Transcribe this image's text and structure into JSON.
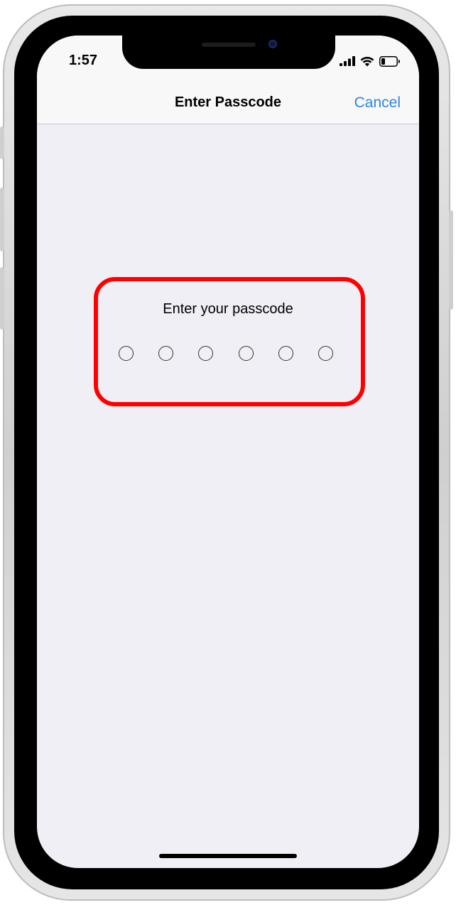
{
  "status_bar": {
    "time": "1:57",
    "icons": [
      "cellular-signal-icon",
      "wifi-icon",
      "battery-icon"
    ],
    "battery_level": 0.25
  },
  "nav_bar": {
    "title": "Enter Passcode",
    "cancel_label": "Cancel"
  },
  "passcode": {
    "prompt": "Enter your passcode",
    "digit_count": 6,
    "entered_count": 0
  },
  "colors": {
    "accent": "#2a86e0",
    "highlight": "#ff0000",
    "background": "#f0eff5"
  }
}
